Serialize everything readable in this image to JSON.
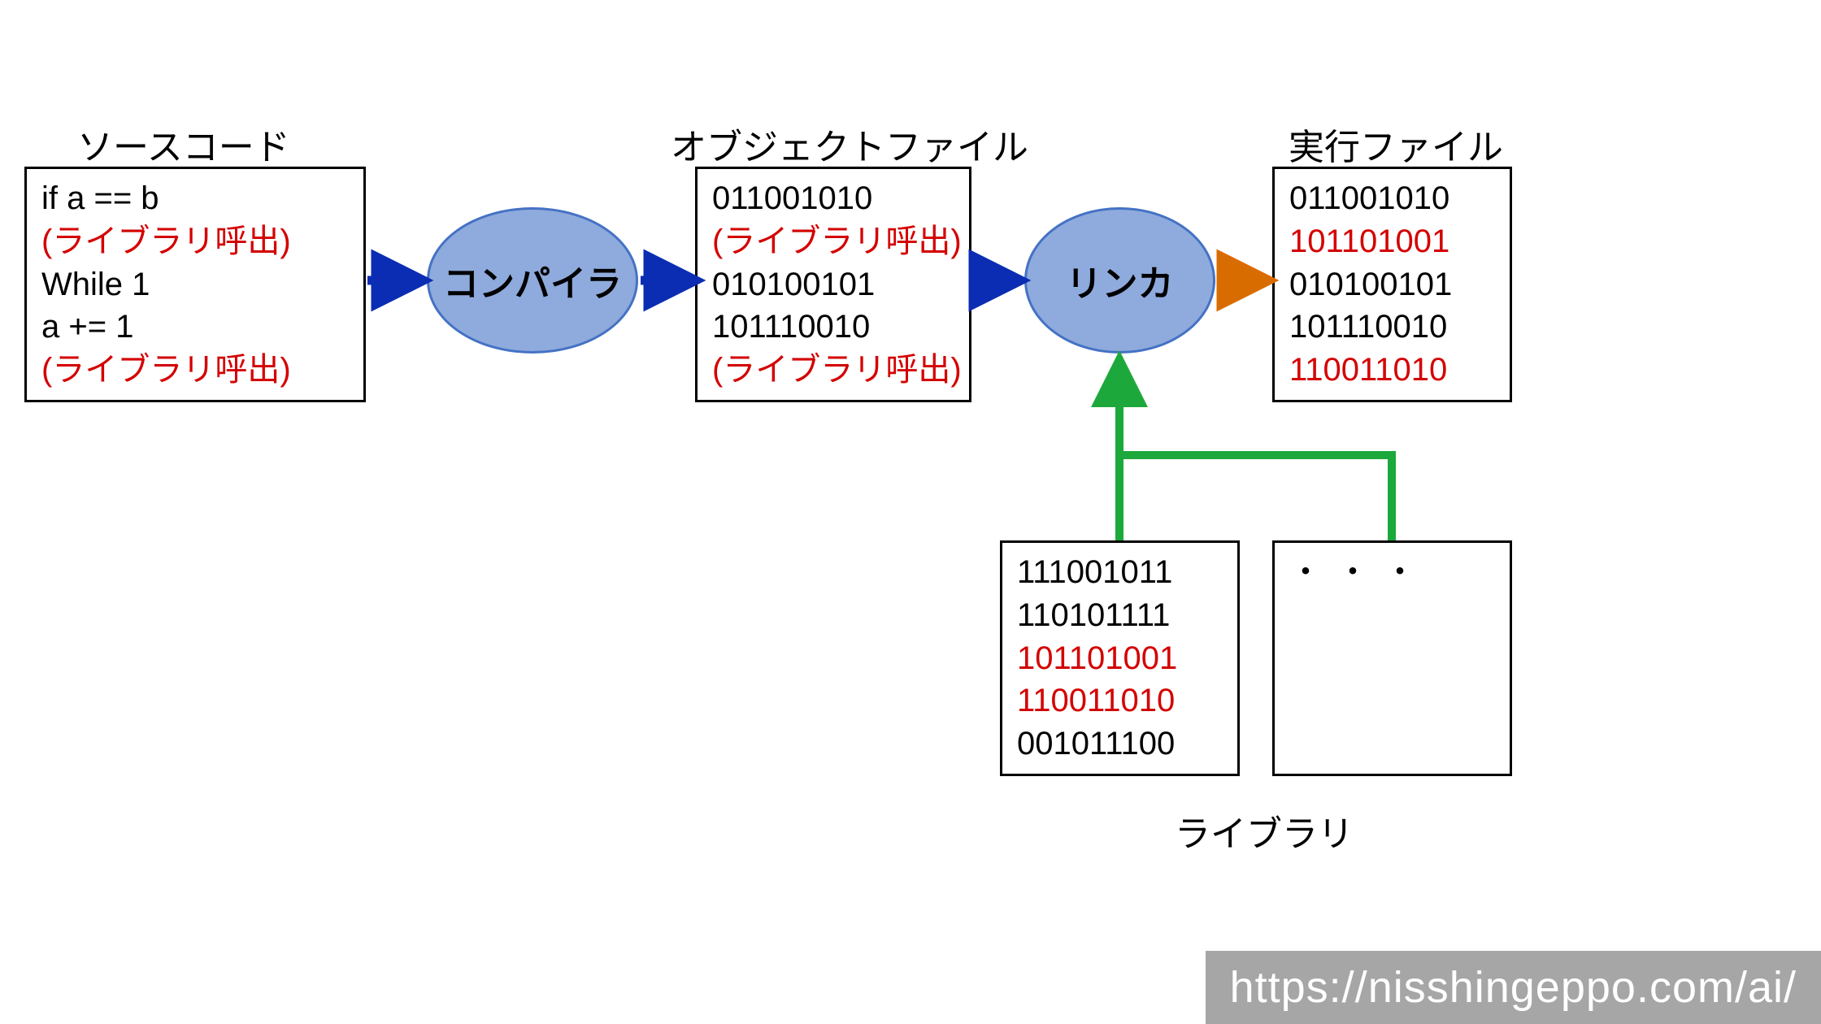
{
  "labels": {
    "source": "ソースコード",
    "object": "オブジェクトファイル",
    "exec": "実行ファイル",
    "library": "ライブラリ"
  },
  "nodes": {
    "compiler": "コンパイラ",
    "linker": "リンカ"
  },
  "source_box": {
    "l1": "if a == b",
    "l2": "(ライブラリ呼出)",
    "l3": "While 1",
    "l4": "a += 1",
    "l5": "(ライブラリ呼出)"
  },
  "object_box": {
    "l1": "011001010",
    "l2": "(ライブラリ呼出)",
    "l3": "010100101",
    "l4": "101110010",
    "l5": "(ライブラリ呼出)"
  },
  "exec_box": {
    "l1": "011001010",
    "l2": "101101001",
    "l3": "010100101",
    "l4": "101110010",
    "l5": "110011010"
  },
  "library_box_1": {
    "l1": "111001011",
    "l2": "110101111",
    "l3": "101101001",
    "l4": "110011010",
    "l5": "001011100"
  },
  "library_box_2": {
    "l1": "・・・"
  },
  "colors": {
    "node_fill": "#8FAADC",
    "node_stroke": "#4472C4",
    "arrow_blue": "#0A2DB3",
    "arrow_orange": "#D96C00",
    "arrow_green": "#1DA83B"
  },
  "watermark": "https://nisshingeppo.com/ai/"
}
